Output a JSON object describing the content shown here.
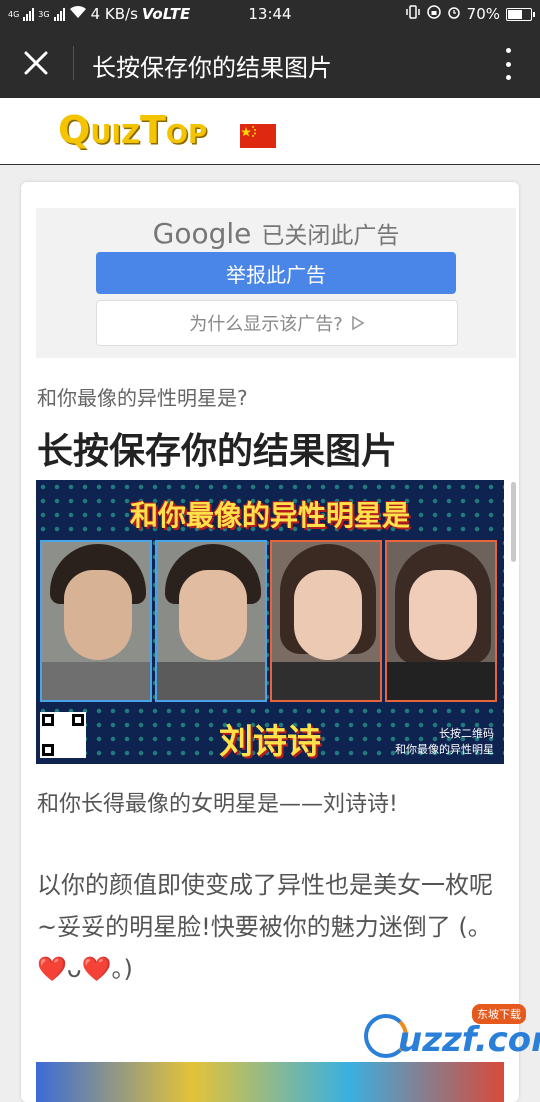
{
  "status_bar": {
    "network_left": "4G",
    "network_left2": "3G",
    "speed": "4 KB/s",
    "volte": "VoLTE",
    "time": "13:44",
    "battery": "70%",
    "battery_level": 0.7
  },
  "titlebar": {
    "title": "长按保存你的结果图片"
  },
  "site": {
    "logo_q": "Q",
    "logo_uiz": "UIZ",
    "logo_t": "T",
    "logo_op": "OP",
    "flag": "china-flag-icon"
  },
  "ad": {
    "brand": "Google",
    "closed_text": "已关闭此广告",
    "report_label": "举报此广告",
    "why_label": "为什么显示该广告?"
  },
  "article": {
    "subtitle": "和你最像的异性明星是?",
    "heading": "长按保存你的结果图片",
    "poster_title": "和你最像的异性明星是",
    "poster_name": "刘诗诗",
    "poster_note_1": "长按二维码",
    "poster_note_2": "和你最像的异性明星",
    "result_line": "和你长得最像的女明星是——刘诗诗!",
    "desc": "以你的颜值即使变成了异性也是美女一枚呢~妥妥的明星脸!快要被你的魅力迷倒了 (。❤️ᴗ❤️。)"
  },
  "watermark": {
    "text": "uzzf.com",
    "badge": "东坡下载"
  },
  "colors": {
    "titlebar_bg": "#2c2c2c",
    "ad_button": "#4a86e8",
    "logo_yellow": "#f5c400"
  }
}
